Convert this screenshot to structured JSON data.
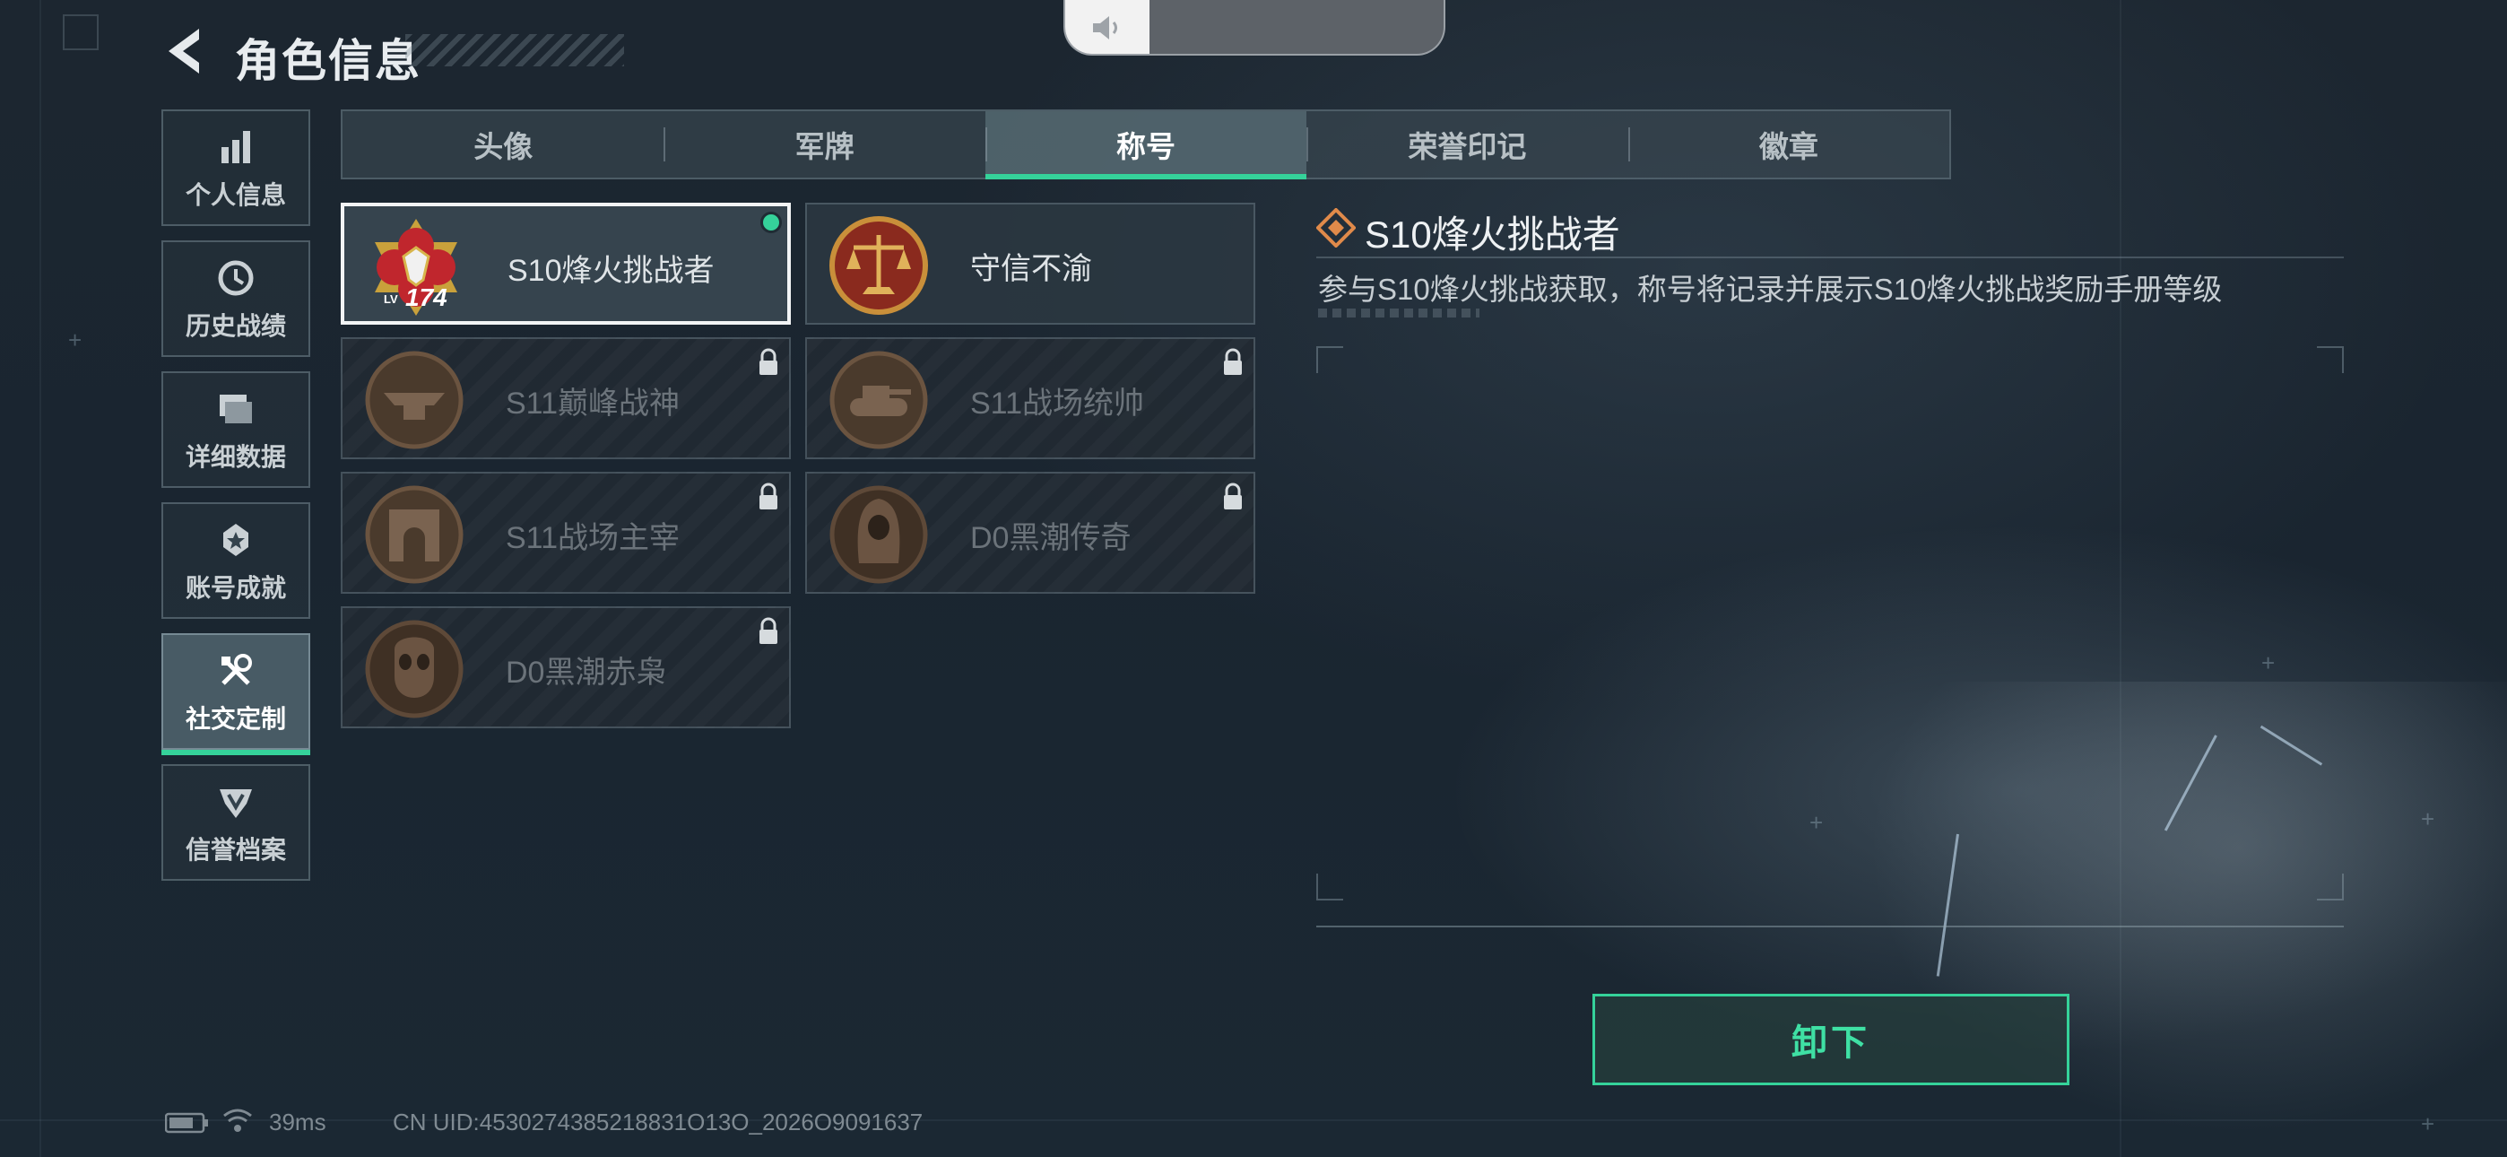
{
  "header": {
    "title": "角色信息",
    "back_icon": "back-chevron-icon"
  },
  "volume": {
    "icon": "speaker-icon"
  },
  "side_nav": {
    "items": [
      {
        "label": "个人信息",
        "icon": "bar-chart-icon",
        "active": false
      },
      {
        "label": "历史战绩",
        "icon": "clock-icon",
        "active": false
      },
      {
        "label": "详细数据",
        "icon": "folder-icon",
        "active": false
      },
      {
        "label": "账号成就",
        "icon": "achievement-star-icon",
        "active": false
      },
      {
        "label": "社交定制",
        "icon": "tools-icon",
        "active": true
      },
      {
        "label": "信誉档案",
        "icon": "shield-badge-icon",
        "active": false
      }
    ]
  },
  "tabs": [
    {
      "label": "头像",
      "active": false
    },
    {
      "label": "军牌",
      "active": false
    },
    {
      "label": "称号",
      "active": true
    },
    {
      "label": "荣誉印记",
      "active": false
    },
    {
      "label": "徽章",
      "active": false
    }
  ],
  "titles": [
    {
      "label": "S10烽火挑战者",
      "emblem": "red-gold-flower-emblem-icon",
      "selected": true,
      "locked": false,
      "equipped": true,
      "level_prefix": "LV",
      "level": "174"
    },
    {
      "label": "守信不渝",
      "emblem": "scales-of-justice-emblem-icon",
      "selected": false,
      "locked": false,
      "equipped": false
    },
    {
      "label": "S11巅峰战神",
      "emblem": "anvil-emblem-icon",
      "selected": false,
      "locked": true,
      "equipped": false
    },
    {
      "label": "S11战场统帅",
      "emblem": "tank-emblem-icon",
      "selected": false,
      "locked": true,
      "equipped": false
    },
    {
      "label": "S11战场主宰",
      "emblem": "arch-emblem-icon",
      "selected": false,
      "locked": true,
      "equipped": false
    },
    {
      "label": "D0黑潮传奇",
      "emblem": "hooded-figure-emblem-icon",
      "selected": false,
      "locked": true,
      "equipped": false
    },
    {
      "label": "D0黑潮赤枭",
      "emblem": "skull-mask-emblem-icon",
      "selected": false,
      "locked": true,
      "equipped": false
    }
  ],
  "detail": {
    "title": "S10烽火挑战者",
    "description": "参与S10烽火挑战获取，称号将记录并展示S10烽火挑战奖励手册等级"
  },
  "action": {
    "unequip_label": "卸下"
  },
  "status_bar": {
    "ping": "39ms",
    "uid": "CN UID:4530274385218831O13O_2026O9091637"
  },
  "colors": {
    "accent_green": "#35d29a",
    "background": "#1c2630"
  }
}
